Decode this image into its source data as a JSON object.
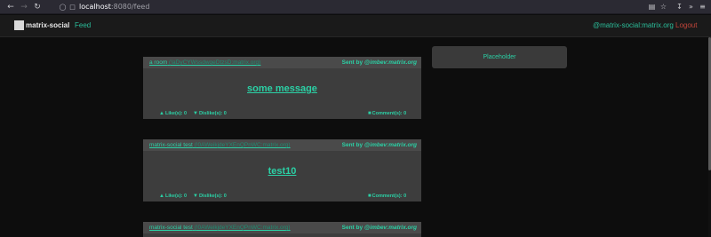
{
  "browser": {
    "url_host": "localhost",
    "url_path": ":8080/feed"
  },
  "header": {
    "brand": "matrix-social",
    "nav_feed": "Feed",
    "user_id": "@matrix-social:matrix.org",
    "logout": "Logout"
  },
  "side_panel": {
    "placeholder": "Placeholder"
  },
  "posts": [
    {
      "room_name": "a room",
      "room_id": "(!aDyCYWssdwqeDtzsD:matrix.org)",
      "sent_prefix": "Sent by ",
      "sender": "@imbev:matrix.org",
      "message": "some message",
      "likes": "Like(s): 0",
      "dislikes": "Dislike(s): 0",
      "comments": "Comment(s): 0"
    },
    {
      "room_name": "matrix-social test",
      "room_id": "(!0AWeikjdeYXEnQPnWC:matrix.org)",
      "sent_prefix": "Sent by ",
      "sender": "@imbev:matrix.org",
      "message": "test10",
      "likes": "Like(s): 0",
      "dislikes": "Dislike(s): 0",
      "comments": "Comment(s): 0"
    },
    {
      "room_name": "matrix-social test",
      "room_id": "(!0AWeikjdeYXEnQPnWC:matrix.org)",
      "sent_prefix": "Sent by ",
      "sender": "@imbev:matrix.org"
    }
  ],
  "colors": {
    "accent": "#2bd0a5",
    "logout": "#c2453a",
    "background": "#0d0d0d",
    "card": "#3d3d3d"
  }
}
